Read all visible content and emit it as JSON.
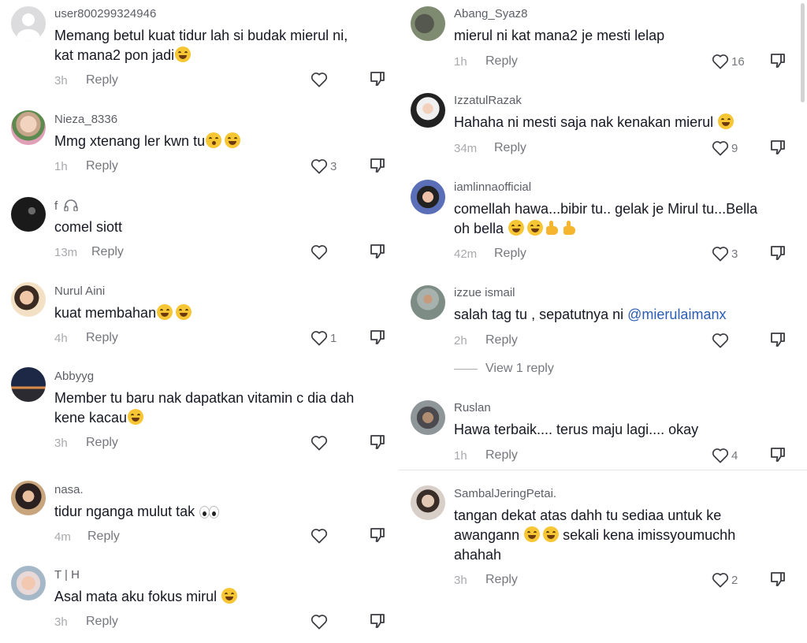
{
  "colors": {
    "text_primary": "#161823",
    "username": "#5c5f66",
    "meta": "#a8a9ad",
    "mention": "#2b5db5"
  },
  "left_comments": [
    {
      "username": "user800299324946",
      "lines": [
        "Memang betul kuat tidur lah si budak mierul ni,",
        "kat mana2 pon jadi"
      ],
      "emoji": [
        "laughing-crying"
      ],
      "time": "3h",
      "reply": "Reply",
      "likes": ""
    },
    {
      "username": "Nieza_8336",
      "lines": [
        "Mmg xtenang ler kwn tu"
      ],
      "emoji": [
        "hand-over-mouth",
        "rolling-laughing"
      ],
      "time": "1h",
      "reply": "Reply",
      "likes": "3"
    },
    {
      "username": "f",
      "lines": [
        "comel siott"
      ],
      "emoji": [],
      "time": "13m",
      "reply": "Reply",
      "likes": ""
    },
    {
      "username": "Nurul Aini",
      "lines": [
        "kuat membahan"
      ],
      "emoji": [
        "grinning-squint",
        "grinning-squint"
      ],
      "time": "4h",
      "reply": "Reply",
      "likes": "1"
    },
    {
      "username": "Abbyyg",
      "lines": [
        "Member tu baru nak dapatkan vitamin c dia dah",
        "kene kacau"
      ],
      "emoji": [
        "laughing-crying"
      ],
      "time": "3h",
      "reply": "Reply",
      "likes": ""
    },
    {
      "username": "nasa.",
      "lines": [
        "tidur nganga mulut tak"
      ],
      "emoji": [
        "eyes"
      ],
      "time": "4m",
      "reply": "Reply",
      "likes": ""
    },
    {
      "username": "T | H",
      "lines": [
        "Asal mata aku fokus mirul"
      ],
      "emoji": [
        "loudly-crying"
      ],
      "time": "3h",
      "reply": "Reply",
      "likes": ""
    }
  ],
  "right_comments": [
    {
      "username": "Abang_Syaz8",
      "lines": [
        "mierul ni kat mana2 je mesti lelap"
      ],
      "time": "1h",
      "reply": "Reply",
      "likes": "16"
    },
    {
      "username": "IzzatulRazak",
      "lines": [
        "Hahaha ni mesti saja nak kenakan mierul"
      ],
      "time": "34m",
      "reply": "Reply",
      "likes": "9"
    },
    {
      "username": "iamlinnaofficial",
      "lines": [
        "comellah hawa...bibir tu.. gelak je Mirul tu...Bella",
        "oh bella"
      ],
      "time": "42m",
      "reply": "Reply",
      "likes": "3"
    },
    {
      "username": "izzue ismail",
      "line_prefix": "salah tag tu , sepatutnya ni ",
      "mention": "@mierulaimanx",
      "time": "2h",
      "reply": "Reply",
      "likes": "",
      "view_replies": "View 1 reply"
    },
    {
      "username": "Ruslan",
      "lines": [
        "Hawa terbaik.... terus maju lagi.... okay"
      ],
      "time": "1h",
      "reply": "Reply",
      "likes": "4"
    },
    {
      "username": "SambalJeringPetai.",
      "lines": [
        "tangan dekat atas dahh tu sediaa untuk ke",
        "awangann",
        "sekali kena imissyoumuchh",
        "ahahah"
      ],
      "time": "3h",
      "reply": "Reply",
      "likes": "2"
    }
  ]
}
